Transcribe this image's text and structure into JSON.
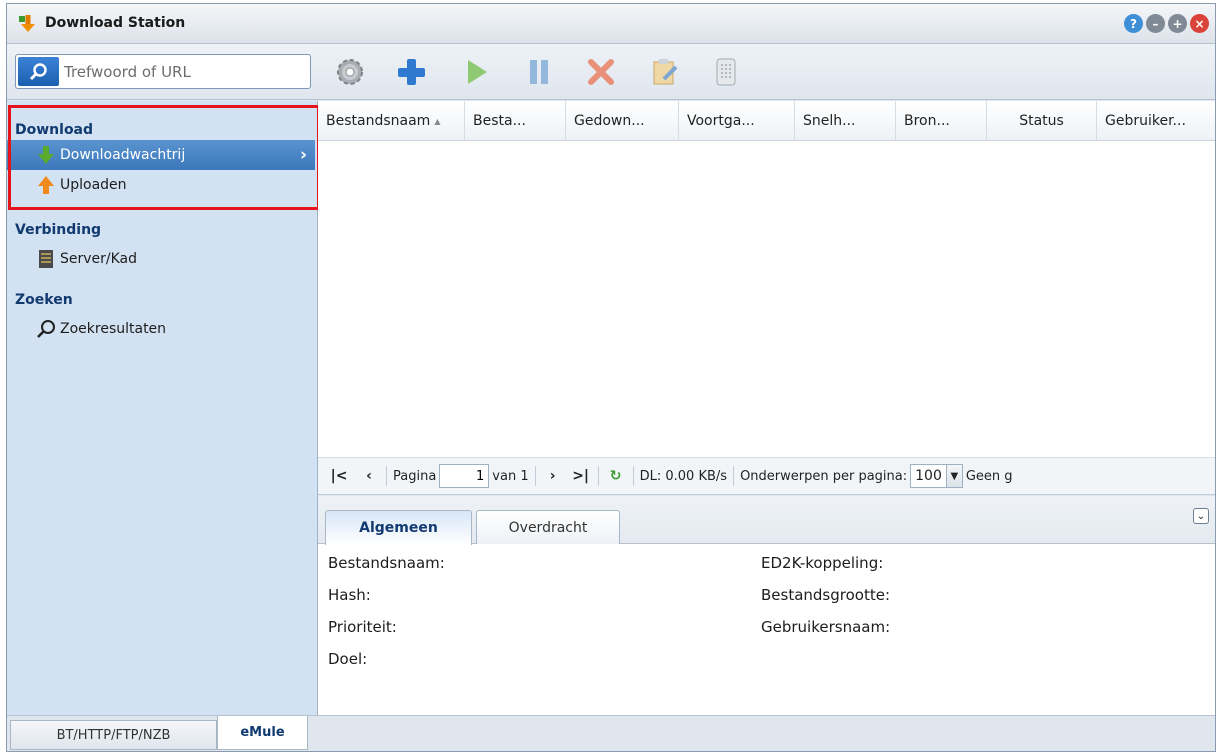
{
  "window": {
    "title": "Download Station"
  },
  "toolbar": {
    "search_placeholder": "Trefwoord of URL",
    "buttons": [
      "settings-icon",
      "add-icon",
      "resume-icon",
      "pause-icon",
      "delete-icon",
      "edit-icon",
      "clear-icon"
    ]
  },
  "sidebar": {
    "section_download": "Download",
    "item_queue": "Downloadwachtrij",
    "item_upload": "Uploaden",
    "section_connection": "Verbinding",
    "item_server": "Server/Kad",
    "section_search": "Zoeken",
    "item_results": "Zoekresultaten"
  },
  "grid": {
    "columns": [
      "Bestandsnaam",
      "Besta...",
      "Gedown...",
      "Voortga...",
      "Snelh...",
      "Bron...",
      "Status",
      "Gebruiker..."
    ]
  },
  "pager": {
    "page_label": "Pagina",
    "page_value": "1",
    "of_label": "van 1",
    "speed": "DL: 0.00 KB/s",
    "per_page_label": "Onderwerpen per pagina:",
    "per_page_value": "100",
    "trailing": "Geen g"
  },
  "detail": {
    "tab_general": "Algemeen",
    "tab_transfer": "Overdracht",
    "filename": "Bestandsnaam:",
    "hash": "Hash:",
    "priority": "Prioriteit:",
    "target": "Doel:",
    "ed2k": "ED2K-koppeling:",
    "filesize": "Bestandsgrootte:",
    "username": "Gebruikersnaam:"
  },
  "bottom_tabs": {
    "bt": "BT/HTTP/FTP/NZB",
    "emule": "eMule"
  },
  "colors": {
    "accent": "#3c78bb",
    "highlight": "#e5141b",
    "sidebar_bg": "#d3e2f2"
  }
}
